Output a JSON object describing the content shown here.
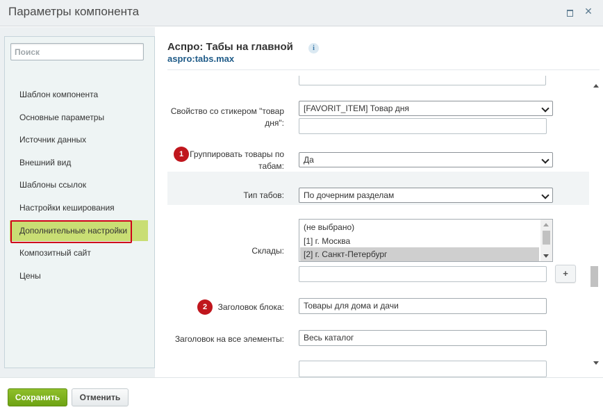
{
  "window": {
    "title": "Параметры компонента",
    "maximize_icon": "maximize-icon",
    "close_icon": "close-icon"
  },
  "sidebar": {
    "search_placeholder": "Поиск",
    "items": [
      {
        "label": "Шаблон компонента"
      },
      {
        "label": "Основные параметры"
      },
      {
        "label": "Источник данных"
      },
      {
        "label": "Внешний вид"
      },
      {
        "label": "Шаблоны ссылок"
      },
      {
        "label": "Настройки кеширования"
      },
      {
        "label": "Дополнительные настройки",
        "active": true
      },
      {
        "label": "Композитный сайт"
      },
      {
        "label": "Цены"
      }
    ]
  },
  "main": {
    "title": "Аспро: Табы на главной",
    "subtitle": "aspro:tabs.max",
    "info_icon": "info-icon",
    "form": {
      "sticker_label": "Свойство со стикером \"товар дня\":",
      "sticker_value": "[FAVORIT_ITEM] Товар дня",
      "group_badge": "1",
      "group_label": "Группировать товары по табам:",
      "group_value": "Да",
      "tab_type_label": "Тип табов:",
      "tab_type_value": "По дочерним разделам",
      "stores_label": "Склады:",
      "stores_options": [
        "(не выбрано)",
        "[1] г. Москва",
        "[2] г. Санкт-Петербург"
      ],
      "stores_selected_index": 2,
      "add_button": "+",
      "block_title_badge": "2",
      "block_title_label": "Заголовок блока:",
      "block_title_value": "Товары для дома и дачи",
      "all_title_label": "Заголовок на все элементы:",
      "all_title_value": "Весь каталог"
    }
  },
  "footer": {
    "save_label": "Сохранить",
    "cancel_label": "Отменить"
  },
  "colors": {
    "active_item_bg": "#c9de74",
    "highlight_frame": "#d0021b",
    "badge": "#c0161d",
    "save_button": "#7cb01e",
    "subtitle_link": "#1f5b88"
  }
}
